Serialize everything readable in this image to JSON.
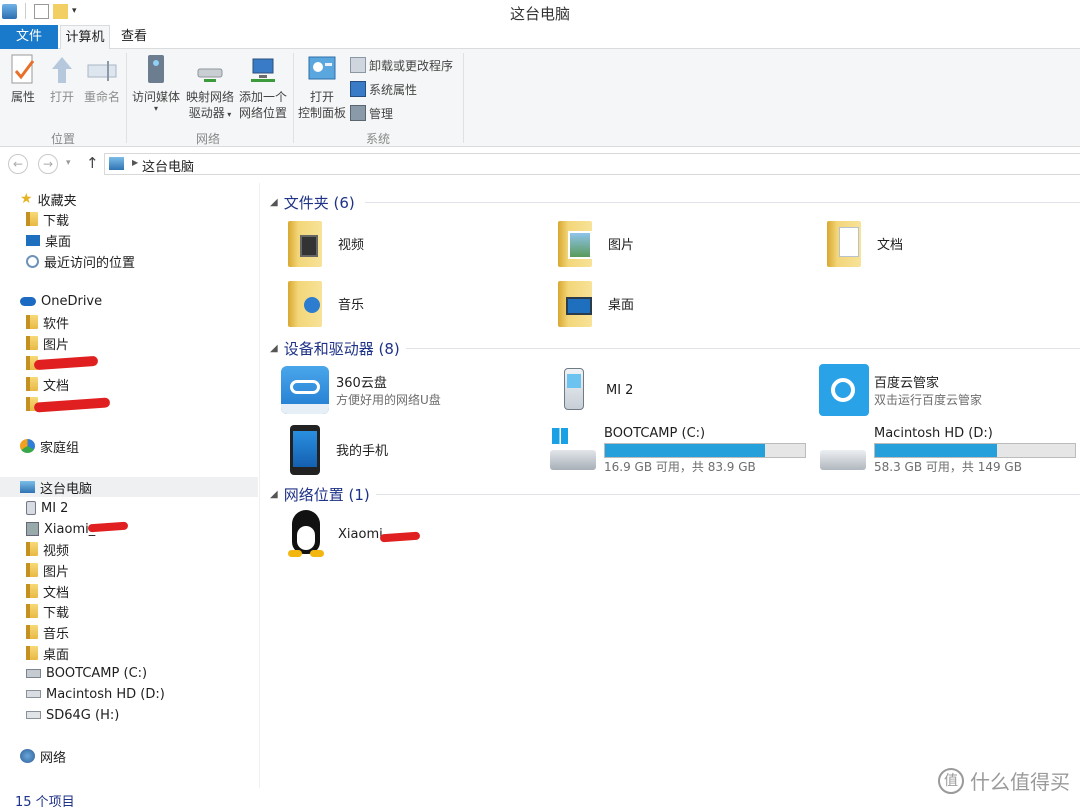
{
  "window": {
    "title": "这台电脑"
  },
  "tabs": {
    "file": "文件",
    "computer": "计算机",
    "view": "查看"
  },
  "ribbon": {
    "properties": "属性",
    "open": "打开",
    "rename": "重命名",
    "access_media_l1": "访问媒体",
    "map_drive_l1": "映射网络",
    "map_drive_l2": "驱动器",
    "add_location_l1": "添加一个",
    "add_location_l2": "网络位置",
    "open_cp_l1": "打开",
    "open_cp_l2": "控制面板",
    "uninstall": "卸载或更改程序",
    "sys_props": "系统属性",
    "manage": "管理",
    "group_location": "位置",
    "group_network": "网络",
    "group_system": "系统"
  },
  "address": {
    "path": "这台电脑"
  },
  "nav": {
    "favorites": "收藏夹",
    "downloads": "下载",
    "desktop": "桌面",
    "recent": "最近访问的位置",
    "onedrive": "OneDrive",
    "od_software": "软件",
    "od_pictures": "图片",
    "od_documents": "文档",
    "homegroup": "家庭组",
    "this_pc": "这台电脑",
    "mi2": "MI 2",
    "xiaomi": "Xiaomi_",
    "videos": "视频",
    "pictures": "图片",
    "documents": "文档",
    "downloads2": "下载",
    "music": "音乐",
    "desktop2": "桌面",
    "bootcamp": "BOOTCAMP (C:)",
    "mac": "Macintosh HD (D:)",
    "sd": "SD64G (H:)",
    "network": "网络"
  },
  "groups": {
    "folders": "文件夹 (6)",
    "devices": "设备和驱动器 (8)",
    "netloc": "网络位置 (1)"
  },
  "folders": {
    "videos": "视频",
    "pictures": "图片",
    "documents": "文档",
    "music": "音乐",
    "desktop": "桌面"
  },
  "devices": {
    "cloud360_name": "360云盘",
    "cloud360_sub": "方便好用的网络U盘",
    "mi2": "MI 2",
    "baidu_name": "百度云管家",
    "baidu_sub": "双击运行百度云管家",
    "phone": "我的手机",
    "c_name": "BOOTCAMP (C:)",
    "c_space": "16.9 GB 可用，共 83.9 GB",
    "c_used_fraction": 0.8,
    "d_name": "Macintosh HD (D:)",
    "d_space": "58.3 GB 可用，共 149 GB",
    "d_used_fraction": 0.61
  },
  "netloc": {
    "xiaomi": "Xiaomi_"
  },
  "status": {
    "count": "15 个项目"
  },
  "watermark": {
    "text": "什么值得买",
    "badge": "值"
  },
  "colors": {
    "accent": "#1979ca",
    "drive_bar": "#26a0da",
    "group_header": "#1e3287"
  }
}
